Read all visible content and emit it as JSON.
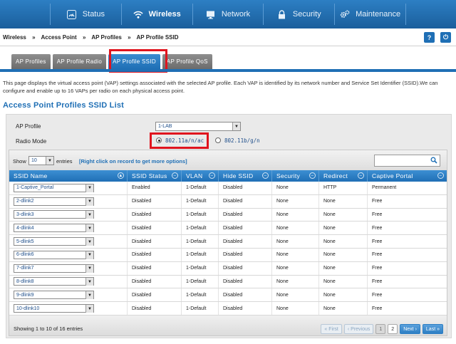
{
  "nav": {
    "items": [
      {
        "label": "Status",
        "icon": "gauge-icon"
      },
      {
        "label": "Wireless",
        "icon": "wifi-icon"
      },
      {
        "label": "Network",
        "icon": "monitor-icon"
      },
      {
        "label": "Security",
        "icon": "lock-icon"
      },
      {
        "label": "Maintenance",
        "icon": "gears-icon"
      }
    ],
    "active": "Wireless"
  },
  "breadcrumb": [
    "Wireless",
    "»",
    "Access Point",
    "»",
    "AP Profiles",
    "»",
    "AP Profile SSID"
  ],
  "help_label": "?",
  "logout_label": "⏻",
  "tabs": [
    {
      "label": "AP Profiles"
    },
    {
      "label": "AP Profile Radio"
    },
    {
      "label": "AP Profile SSID"
    },
    {
      "label": "AP Profile QoS"
    }
  ],
  "description": "This page displays the virtual access point (VAP) settings associated with the selected AP profile. Each VAP is identified by its network number and Service Set Identifier (SSID).We can configure and enable up to 16 VAPs per radio on each physical access point.",
  "section_title": "Access Point Profiles SSID List",
  "form": {
    "ap_profile_label": "AP Profile",
    "ap_profile_value": "1-LAB",
    "radio_mode_label": "Radio Mode",
    "radio_options": [
      "802.11a/n/ac",
      "802.11b/g/n"
    ],
    "radio_selected": "802.11a/n/ac"
  },
  "table": {
    "show_label": "Show",
    "entries_value": "10",
    "entries_label": "entries",
    "right_click_hint": "[Right click on record to get more options]",
    "search_placeholder": "",
    "columns": [
      "SSID Name",
      "SSID Status",
      "VLAN",
      "Hide SSID",
      "Security",
      "Redirect",
      "Captive Portal"
    ],
    "rows": [
      [
        "1-Captive_Portal",
        "Enabled",
        "1-Default",
        "Disabled",
        "None",
        "HTTP",
        "Permanent"
      ],
      [
        "2-dlink2",
        "Disabled",
        "1-Default",
        "Disabled",
        "None",
        "None",
        "Free"
      ],
      [
        "3-dlink3",
        "Disabled",
        "1-Default",
        "Disabled",
        "None",
        "None",
        "Free"
      ],
      [
        "4-dlink4",
        "Disabled",
        "1-Default",
        "Disabled",
        "None",
        "None",
        "Free"
      ],
      [
        "5-dlink5",
        "Disabled",
        "1-Default",
        "Disabled",
        "None",
        "None",
        "Free"
      ],
      [
        "6-dlink6",
        "Disabled",
        "1-Default",
        "Disabled",
        "None",
        "None",
        "Free"
      ],
      [
        "7-dlink7",
        "Disabled",
        "1-Default",
        "Disabled",
        "None",
        "None",
        "Free"
      ],
      [
        "8-dlink8",
        "Disabled",
        "1-Default",
        "Disabled",
        "None",
        "None",
        "Free"
      ],
      [
        "9-dlink9",
        "Disabled",
        "1-Default",
        "Disabled",
        "None",
        "None",
        "Free"
      ],
      [
        "10-dlink10",
        "Disabled",
        "1-Default",
        "Disabled",
        "None",
        "None",
        "Free"
      ]
    ],
    "showing_text": "Showing 1 to 10 of 16 entries",
    "pager": [
      "First",
      "Previous",
      "1",
      "2",
      "Next",
      "Last"
    ],
    "current_page": "1"
  },
  "colors": {
    "brand_blue": "#1f6fb5",
    "highlight_red": "#e0141e"
  }
}
